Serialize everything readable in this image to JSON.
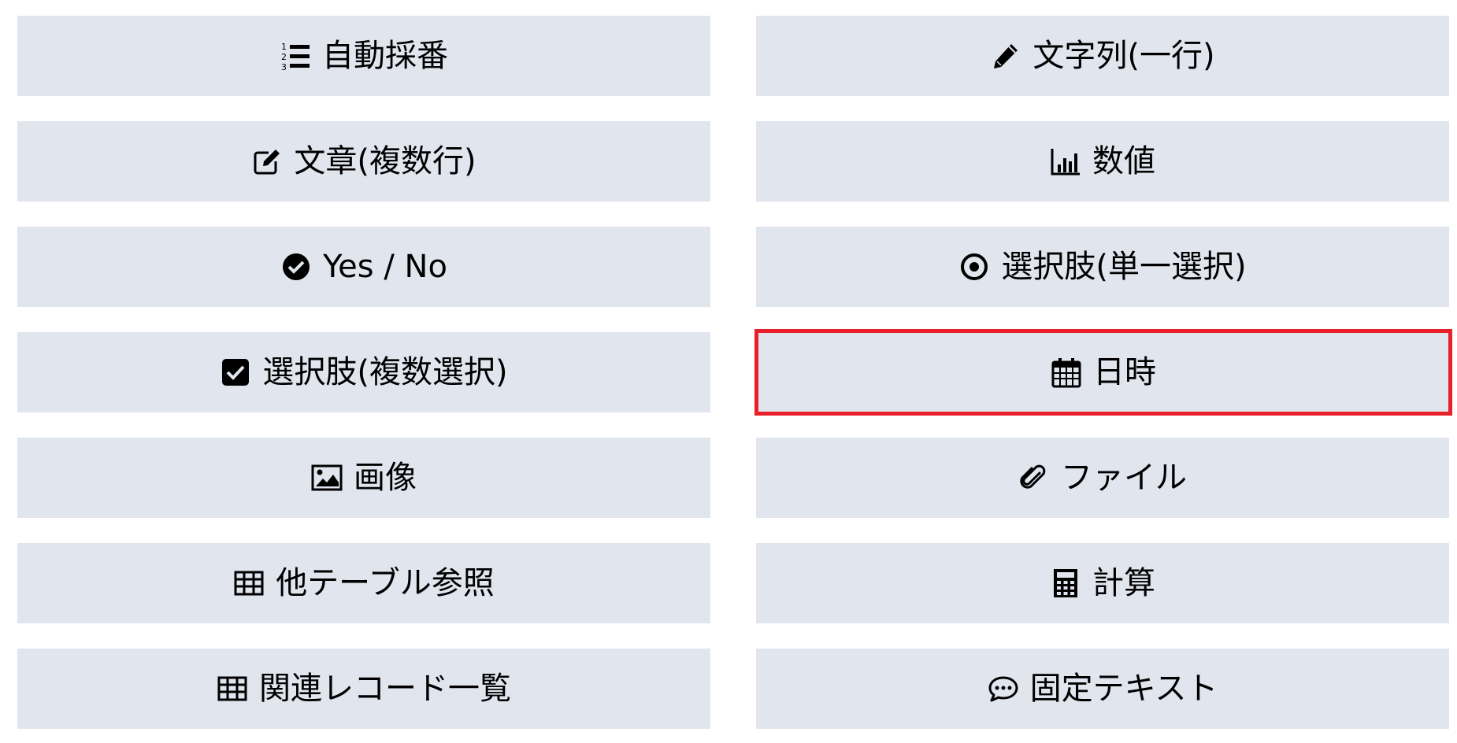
{
  "field_types": [
    {
      "icon": "list-ol-icon",
      "label": "自動採番",
      "selected": false
    },
    {
      "icon": "pencil-icon",
      "label": "文字列(一行)",
      "selected": false
    },
    {
      "icon": "edit-square-icon",
      "label": "文章(複数行)",
      "selected": false
    },
    {
      "icon": "bar-chart-icon",
      "label": "数値",
      "selected": false
    },
    {
      "icon": "check-circle-icon",
      "label": "Yes / No",
      "selected": false
    },
    {
      "icon": "dot-circle-icon",
      "label": "選択肢(単一選択)",
      "selected": false
    },
    {
      "icon": "check-square-icon",
      "label": "選択肢(複数選択)",
      "selected": false
    },
    {
      "icon": "calendar-icon",
      "label": "日時",
      "selected": true
    },
    {
      "icon": "image-icon",
      "label": "画像",
      "selected": false
    },
    {
      "icon": "paperclip-icon",
      "label": "ファイル",
      "selected": false
    },
    {
      "icon": "table-icon",
      "label": "他テーブル参照",
      "selected": false
    },
    {
      "icon": "calculator-icon",
      "label": "計算",
      "selected": false
    },
    {
      "icon": "table-icon",
      "label": "関連レコード一覧",
      "selected": false
    },
    {
      "icon": "comments-icon",
      "label": "固定テキスト",
      "selected": false
    }
  ],
  "colors": {
    "button_bg": "#e1e5ee",
    "selected_border": "#e8202a",
    "text": "#000000"
  }
}
